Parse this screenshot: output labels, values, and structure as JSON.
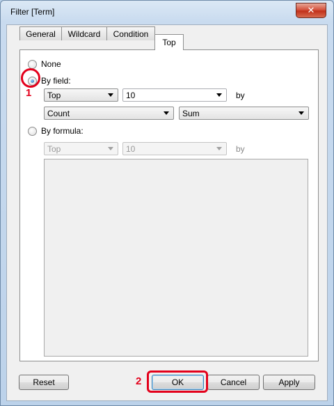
{
  "window": {
    "title": "Filter [Term]",
    "close_glyph": "✕"
  },
  "tabs": [
    {
      "label": "General",
      "active": false
    },
    {
      "label": "Wildcard",
      "active": false
    },
    {
      "label": "Condition",
      "active": false
    },
    {
      "label": "Top",
      "active": true
    }
  ],
  "options": {
    "none_label": "None",
    "by_field_label": "By field:",
    "by_formula_label": "By formula:",
    "selected": "by_field"
  },
  "by_field": {
    "direction": "Top",
    "count": "10",
    "by_label": "by",
    "field": "Count",
    "aggregation": "Sum"
  },
  "by_formula": {
    "direction": "Top",
    "count": "10",
    "by_label": "by"
  },
  "buttons": {
    "reset": "Reset",
    "ok": "OK",
    "cancel": "Cancel",
    "apply": "Apply"
  },
  "annotations": {
    "step1": "1",
    "step2": "2",
    "color": "#e3001b"
  },
  "colors": {
    "title_bg": "#c9dbef",
    "close_red": "#c1311a",
    "panel_bg": "#ffffff",
    "dialog_bg": "#f0f0f0"
  }
}
